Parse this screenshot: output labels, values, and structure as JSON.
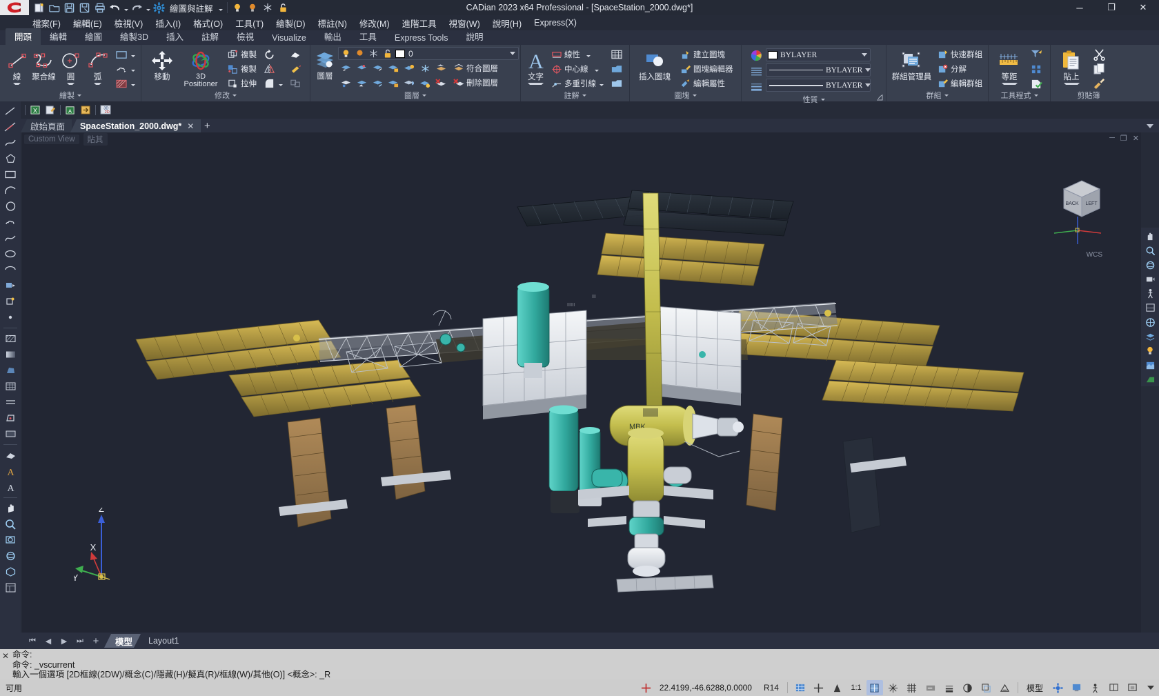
{
  "window": {
    "title": "CADian 2023 x64 Professional - [SpaceStation_2000.dwg*]",
    "minimize": "─",
    "maximize": "❐",
    "close": "✕"
  },
  "quick_access": {
    "workspace_label": "繪圖與註解",
    "items": [
      {
        "name": "new-drawing-icon",
        "label": "新建"
      },
      {
        "name": "open-folder-icon",
        "label": "開啟"
      },
      {
        "name": "save-icon",
        "label": "儲存"
      },
      {
        "name": "save-as-icon",
        "label": "另存新檔"
      },
      {
        "name": "print-icon",
        "label": "列印"
      },
      {
        "name": "undo-icon",
        "label": "復原"
      },
      {
        "name": "redo-icon",
        "label": "重做"
      },
      {
        "name": "workspace-gear-icon",
        "label": "工作區"
      }
    ]
  },
  "menubar": [
    "檔案(F)",
    "編輯(E)",
    "檢視(V)",
    "插入(I)",
    "格式(O)",
    "工具(T)",
    "繪製(D)",
    "標註(N)",
    "修改(M)",
    "進階工具",
    "視窗(W)",
    "說明(H)",
    "Express(X)"
  ],
  "ribbon_tabs": [
    {
      "label": "開頭",
      "active": true
    },
    {
      "label": "編輯",
      "active": false
    },
    {
      "label": "繪圖",
      "active": false
    },
    {
      "label": "繪製3D",
      "active": false
    },
    {
      "label": "插入",
      "active": false
    },
    {
      "label": "註解",
      "active": false
    },
    {
      "label": "檢視",
      "active": false
    },
    {
      "label": "Visualize",
      "active": false
    },
    {
      "label": "輸出",
      "active": false
    },
    {
      "label": "工具",
      "active": false
    },
    {
      "label": "Express Tools",
      "active": false
    },
    {
      "label": "說明",
      "active": false
    }
  ],
  "ribbon": {
    "draw": {
      "title": "繪製",
      "line": "線",
      "polyline": "聚合線",
      "circle": "圓",
      "arc": "弧"
    },
    "modify": {
      "title": "修改",
      "move": "移動",
      "positioner": "3D Positioner",
      "copy": "複製",
      "copy2": "複製",
      "stretch": "拉伸"
    },
    "layer": {
      "title": "圖層",
      "main": "圖層",
      "current_layer": "0",
      "match_layer": "符合圖層",
      "delete_layer": "刪除圖層"
    },
    "annotate": {
      "title": "註解",
      "text": "文字",
      "linear": "線性",
      "centerline": "中心線",
      "multileader": "多重引線"
    },
    "block": {
      "title": "圖塊",
      "insert": "插入圖塊",
      "create": "建立圖塊",
      "editor": "圖塊編輯器",
      "edit_attr": "編輯屬性"
    },
    "properties": {
      "title": "性質",
      "color": "BYLAYER",
      "linetype": "BYLAYER",
      "lineweight": "BYLAYER"
    },
    "group": {
      "title": "群組",
      "manager": "群組管理員",
      "quick_group": "快速群組",
      "explode": "分解",
      "edit_group": "編輯群組"
    },
    "utilities": {
      "title": "工具程式",
      "distance": "等距"
    },
    "clipboard": {
      "title": "剪貼簿",
      "paste": "貼上"
    }
  },
  "doc_tabs": [
    {
      "label": "啟始頁面",
      "active": false,
      "closable": false
    },
    {
      "label": "SpaceStation_2000.dwg*",
      "active": true,
      "closable": true,
      "close": "✕"
    }
  ],
  "doc_tab_add": "+",
  "viewport": {
    "view_label": "Custom View",
    "visual_style_label": "貼其",
    "wcs_label": "WCS",
    "viewcube": {
      "front": "BACK",
      "side": "LEFT"
    },
    "axis": {
      "x": "X",
      "y": "Y",
      "z": "Z"
    },
    "win_minimize": "─",
    "win_restore": "❐",
    "win_close": "✕"
  },
  "layout_tabs": {
    "nav": [
      "⏮",
      "◀",
      "▶",
      "⏭"
    ],
    "add": "+",
    "tabs": [
      {
        "label": "模型",
        "active": true
      },
      {
        "label": "Layout1",
        "active": false
      }
    ]
  },
  "command": {
    "history": [
      "命令:",
      "命令: _vscurrent",
      "輸入一個選項 [2D框線(2DW)/概念(C)/隱藏(H)/擬真(R)/框線(W)/其他(O)] <概念>: _R"
    ],
    "prompt": "命令:",
    "input_value": ""
  },
  "statusbar": {
    "state": "可用",
    "coordinates": "22.4199,-46.6288,0.0000",
    "release": "R14",
    "scale": "1:1",
    "space": "模型",
    "buttons": [
      {
        "name": "snap-toggle",
        "glyph": "✚",
        "on": false
      },
      {
        "name": "grid-toggle",
        "glyph": "⌗",
        "on": false
      },
      {
        "name": "ortho-toggle",
        "glyph": "⊢",
        "on": false
      },
      {
        "name": "polar-toggle",
        "glyph": "✡",
        "on": false
      },
      {
        "name": "osnap-toggle",
        "glyph": "◻",
        "on": true
      },
      {
        "name": "otrack-toggle",
        "glyph": "✵",
        "on": false
      },
      {
        "name": "lineweight-toggle",
        "glyph": "≡",
        "on": false
      },
      {
        "name": "transparency-toggle",
        "glyph": "◑",
        "on": false
      },
      {
        "name": "annotation-scale",
        "glyph": "◱",
        "on": false
      },
      {
        "name": "workspace-switch",
        "glyph": "⚙",
        "on": false
      },
      {
        "name": "hardware-accel",
        "glyph": "▣",
        "on": false
      },
      {
        "name": "clean-screen",
        "glyph": "⛶",
        "on": false
      }
    ]
  },
  "colors": {
    "accent": "#4a90d9",
    "ribbon_bg": "#39404f",
    "viewport_bg": "#222633",
    "titlebar_bg": "#252a36",
    "status_bg": "#cdcdcd",
    "solar_panel": "#b8a048",
    "module_white": "#e8eaec",
    "module_teal": "#3fb8ae",
    "module_yellow": "#c8c04e",
    "truss_gray": "#aab0b8",
    "radiator_brown": "#9c7a4e"
  }
}
